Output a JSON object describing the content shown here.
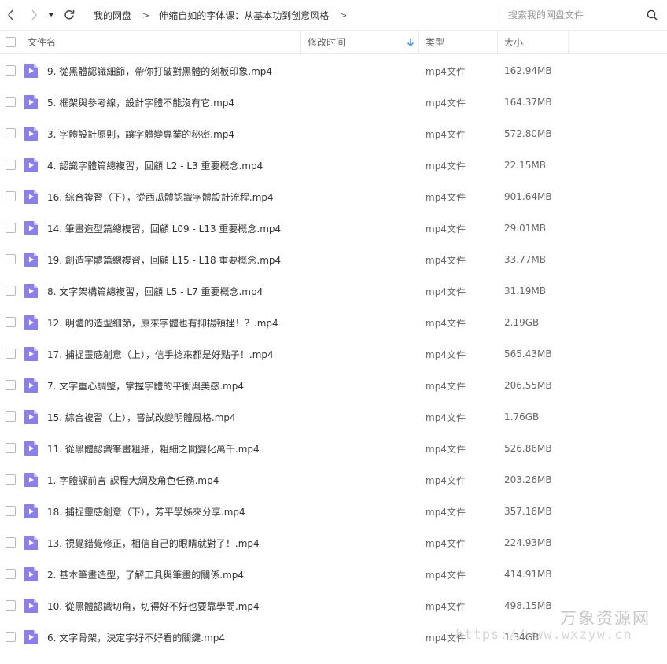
{
  "toolbar": {
    "back_icon": "chevron-left-icon",
    "forward_icon": "chevron-right-icon",
    "history_dropdown_icon": "caret-down-icon",
    "refresh_icon": "refresh-icon"
  },
  "breadcrumb": {
    "root": "我的网盘",
    "separator": ">",
    "current": "伸缩自如的字体课：从基本功到创意风格",
    "trailing": ">"
  },
  "search": {
    "placeholder": "搜索我的网盘文件",
    "value": "",
    "icon": "search-icon"
  },
  "columns": {
    "name": "文件名",
    "modified": "修改时间",
    "type": "类型",
    "size": "大小",
    "sort_icon": "arrow-down-icon"
  },
  "colors": {
    "icon_purple": "#8b7ff0",
    "icon_fold": "#c9c2fb",
    "sort_blue": "#2a8cf0"
  },
  "files": [
    {
      "name": "9. 從黑體認識細節，帶你打破對黑體的刻板印象.mp4",
      "type": "mp4文件",
      "size": "162.94MB"
    },
    {
      "name": "5. 框架與參考線，設計字體不能沒有它.mp4",
      "type": "mp4文件",
      "size": "164.37MB"
    },
    {
      "name": "3. 字體設計原則，讓字體變專業的秘密.mp4",
      "type": "mp4文件",
      "size": "572.80MB"
    },
    {
      "name": "4. 認識字體篇總複習，回顧 L2 - L3 重要概念.mp4",
      "type": "mp4文件",
      "size": "22.15MB"
    },
    {
      "name": "16. 綜合複習（下），從西瓜體認識字體設計流程.mp4",
      "type": "mp4文件",
      "size": "901.64MB"
    },
    {
      "name": "14. 筆畫造型篇總複習，回顧 L09 - L13 重要概念.mp4",
      "type": "mp4文件",
      "size": "29.01MB"
    },
    {
      "name": "19. 創造字體篇總複習，回顧 L15 - L18 重要概念.mp4",
      "type": "mp4文件",
      "size": "33.77MB"
    },
    {
      "name": "8. 文字架構篇總複習，回顧 L5 - L7 重要概念.mp4",
      "type": "mp4文件",
      "size": "31.19MB"
    },
    {
      "name": "12. 明體的造型細節，原來字體也有抑揚頓挫！？.mp4",
      "type": "mp4文件",
      "size": "2.19GB"
    },
    {
      "name": "17. 捕捉靈感創意（上），信手捻來都是好點子！.mp4",
      "type": "mp4文件",
      "size": "565.43MB"
    },
    {
      "name": "7. 文字重心調整，掌握字體的平衡與美感.mp4",
      "type": "mp4文件",
      "size": "206.55MB"
    },
    {
      "name": "15. 綜合複習（上），嘗試改變明體風格.mp4",
      "type": "mp4文件",
      "size": "1.76GB"
    },
    {
      "name": "11. 從黑體認識筆畫粗細，粗細之間變化萬千.mp4",
      "type": "mp4文件",
      "size": "526.86MB"
    },
    {
      "name": "1. 字體課前言-課程大綱及角色任務.mp4",
      "type": "mp4文件",
      "size": "203.26MB"
    },
    {
      "name": "18. 捕捉靈感創意（下），芳平學姊來分享.mp4",
      "type": "mp4文件",
      "size": "357.16MB"
    },
    {
      "name": "13. 視覺錯覺修正，相信自己的眼睛就對了！.mp4",
      "type": "mp4文件",
      "size": "224.93MB"
    },
    {
      "name": "2. 基本筆畫造型，了解工具與筆畫的關係.mp4",
      "type": "mp4文件",
      "size": "414.91MB"
    },
    {
      "name": "10. 從黑體認識切角，切得好不好也要靠學問.mp4",
      "type": "mp4文件",
      "size": "498.15MB"
    },
    {
      "name": "6. 文字骨架，決定字好不好看的關鍵.mp4",
      "type": "mp4文件",
      "size": "1.34GB"
    }
  ],
  "watermark": {
    "title": "万象资源网",
    "url": "https://www.wxzyw.cn"
  }
}
